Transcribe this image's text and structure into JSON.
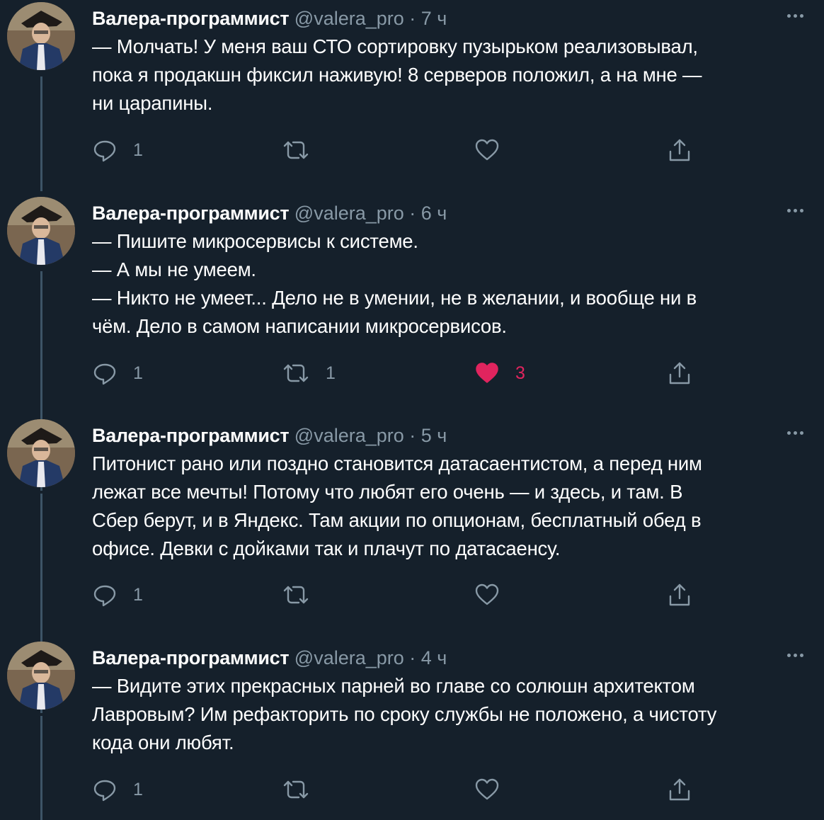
{
  "colors": {
    "background": "#15202b",
    "text": "#ffffff",
    "muted": "#8899a6",
    "like": "#e0245e",
    "thread": "#3d5466"
  },
  "tweets": [
    {
      "name": "Валера-программист",
      "handle": "@valera_pro",
      "time": "· 7 ч",
      "text": "— Молчать! У меня ваш СТО сортировку пузырьком реализовывал,\nпока я продакшн фиксил наживую! 8 серверов положил, а на мне —\nни царапины.",
      "replies": "1",
      "retweets": "",
      "likes": "",
      "liked": false
    },
    {
      "name": "Валера-программист",
      "handle": "@valera_pro",
      "time": "· 6 ч",
      "text": "— Пишите микросервисы к системе.\n— А мы не умеем.\n— Никто не умеет... Дело не в умении, не в желании, и вообще ни в\nчём. Дело в самом написании микросервисов.",
      "replies": "1",
      "retweets": "1",
      "likes": "3",
      "liked": true
    },
    {
      "name": "Валера-программист",
      "handle": "@valera_pro",
      "time": "· 5 ч",
      "text": "Питонист рано или поздно становится датасаентистом, а перед ним\nлежат все мечты! Потому что любят его очень — и здесь, и там. В\nСбер берут, и в Яндекс. Там акции по опционам, бесплатный обед в\nофисе. Девки с дойками так и плачут по датасаенсу.",
      "replies": "1",
      "retweets": "",
      "likes": "",
      "liked": false
    },
    {
      "name": "Валера-программист",
      "handle": "@valera_pro",
      "time": "· 4 ч",
      "text": "— Видите этих прекрасных парней во главе со солюшн архитектом\nЛавровым? Им рефакторить по сроку службы не положено, а чистоту\nкода они любят.",
      "replies": "1",
      "retweets": "",
      "likes": "",
      "liked": false
    }
  ]
}
